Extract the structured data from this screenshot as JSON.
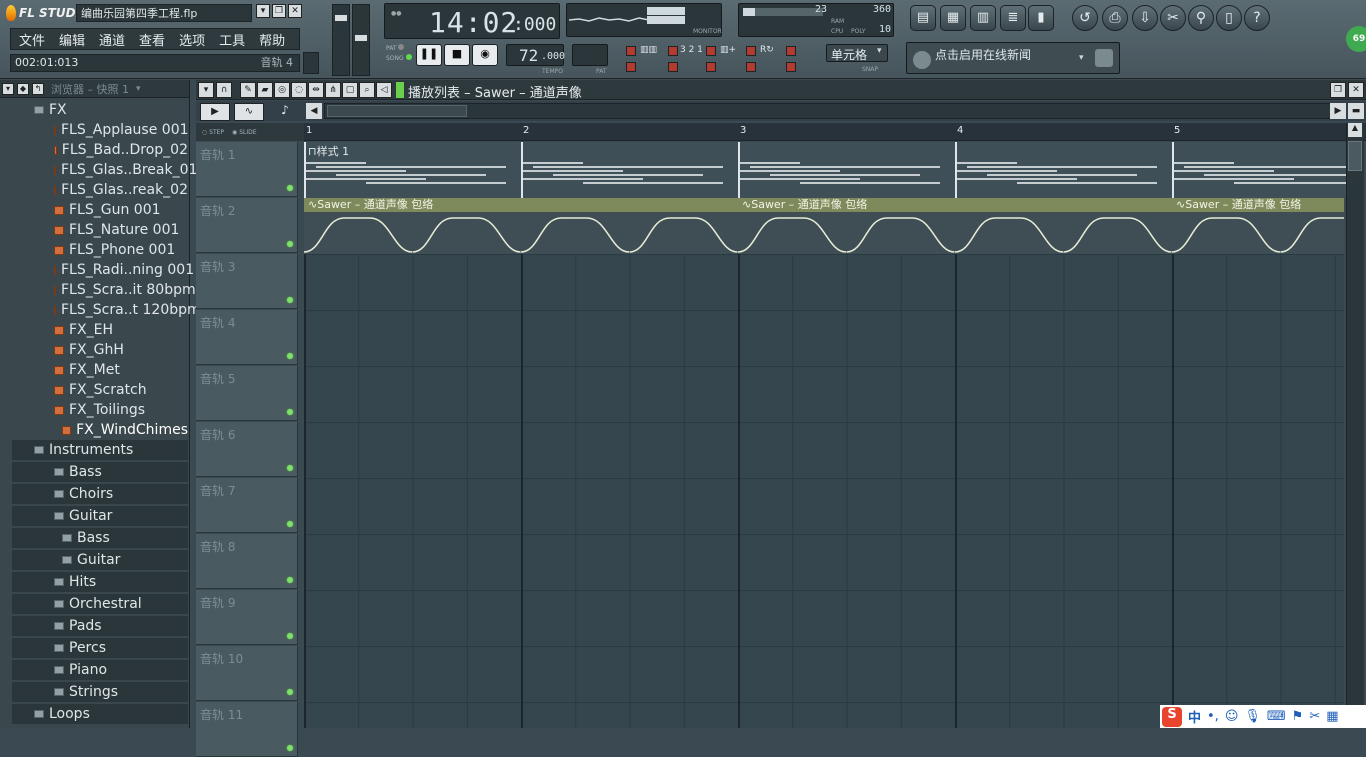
{
  "window": {
    "logo_text": "FL STUDIO",
    "file_title": "编曲乐园第四季工程.flp"
  },
  "menu": [
    "文件",
    "编辑",
    "通道",
    "查看",
    "选项",
    "工具",
    "帮助"
  ],
  "hint_bar": {
    "time": "002:01:013",
    "right_text": "音轨 4"
  },
  "transport": {
    "clock": "14:02",
    "clock_ms": ":000",
    "pat_label": "PAT",
    "song_label": "SONG",
    "tempo_value": "72",
    "tempo_decimal": ".000",
    "tempo_label": "TEMPO",
    "pat_num_label": "PAT",
    "monitor_label": "MONITOR"
  },
  "cpu_panel": {
    "ram_value": "23",
    "poly_value": "360",
    "cpu_label": "CPU",
    "poly_label": "POLY",
    "ram_label": "RAM",
    "voices": "10"
  },
  "snap": {
    "value": "单元格",
    "label": "SNAP"
  },
  "news": {
    "text": "点击启用在线新闻"
  },
  "badge": "69",
  "browser": {
    "title": "浏览器 – 快照 1",
    "items": [
      {
        "label": "FX",
        "type": "folder",
        "indent": 1
      },
      {
        "label": "FLS_Applause 001",
        "type": "file",
        "indent": 2
      },
      {
        "label": "FLS_Bad..Drop_02",
        "type": "file",
        "indent": 2
      },
      {
        "label": "FLS_Glas..Break_01",
        "type": "file",
        "indent": 2
      },
      {
        "label": "FLS_Glas..reak_02",
        "type": "file",
        "indent": 2
      },
      {
        "label": "FLS_Gun 001",
        "type": "file",
        "indent": 2
      },
      {
        "label": "FLS_Nature 001",
        "type": "file",
        "indent": 2
      },
      {
        "label": "FLS_Phone 001",
        "type": "file",
        "indent": 2
      },
      {
        "label": "FLS_Radi..ning 001",
        "type": "file",
        "indent": 2
      },
      {
        "label": "FLS_Scra..it 80bpm",
        "type": "file",
        "indent": 2
      },
      {
        "label": "FLS_Scra..t 120bpm",
        "type": "file",
        "indent": 2
      },
      {
        "label": "FX_EH",
        "type": "file",
        "indent": 2
      },
      {
        "label": "FX_GhH",
        "type": "file",
        "indent": 2
      },
      {
        "label": "FX_Met",
        "type": "file",
        "indent": 2
      },
      {
        "label": "FX_Scratch",
        "type": "file",
        "indent": 2
      },
      {
        "label": "FX_Toilings",
        "type": "file",
        "indent": 2
      },
      {
        "label": "FX_WindChimes",
        "type": "file",
        "indent": 3
      },
      {
        "label": "Instruments",
        "type": "folder",
        "indent": 1
      },
      {
        "label": "Bass",
        "type": "folder",
        "indent": 2
      },
      {
        "label": "Choirs",
        "type": "folder",
        "indent": 2
      },
      {
        "label": "Guitar",
        "type": "folder",
        "indent": 2
      },
      {
        "label": "Bass",
        "type": "folder",
        "indent": 3
      },
      {
        "label": "Guitar",
        "type": "folder",
        "indent": 3
      },
      {
        "label": "Hits",
        "type": "folder",
        "indent": 2
      },
      {
        "label": "Orchestral",
        "type": "folder",
        "indent": 2
      },
      {
        "label": "Pads",
        "type": "folder",
        "indent": 2
      },
      {
        "label": "Percs",
        "type": "folder",
        "indent": 2
      },
      {
        "label": "Piano",
        "type": "folder",
        "indent": 2
      },
      {
        "label": "Strings",
        "type": "folder",
        "indent": 2
      },
      {
        "label": "Loops",
        "type": "folder",
        "indent": 1
      }
    ]
  },
  "playlist": {
    "title": "播放列表 – Sawer – 通道声像",
    "step_label": "STEP",
    "slide_label": "SLIDE",
    "bars": [
      "1",
      "2",
      "3",
      "4",
      "5"
    ],
    "tracks": [
      "音轨 1",
      "音轨 2",
      "音轨 3",
      "音轨 4",
      "音轨 5",
      "音轨 6",
      "音轨 7",
      "音轨 8",
      "音轨 9",
      "音轨 10",
      "音轨 11"
    ],
    "pattern_clip_name": "样式 1",
    "automation_clip_name": "Sawer – 通道声像 包络"
  },
  "tray": {
    "ime_char": "中"
  }
}
